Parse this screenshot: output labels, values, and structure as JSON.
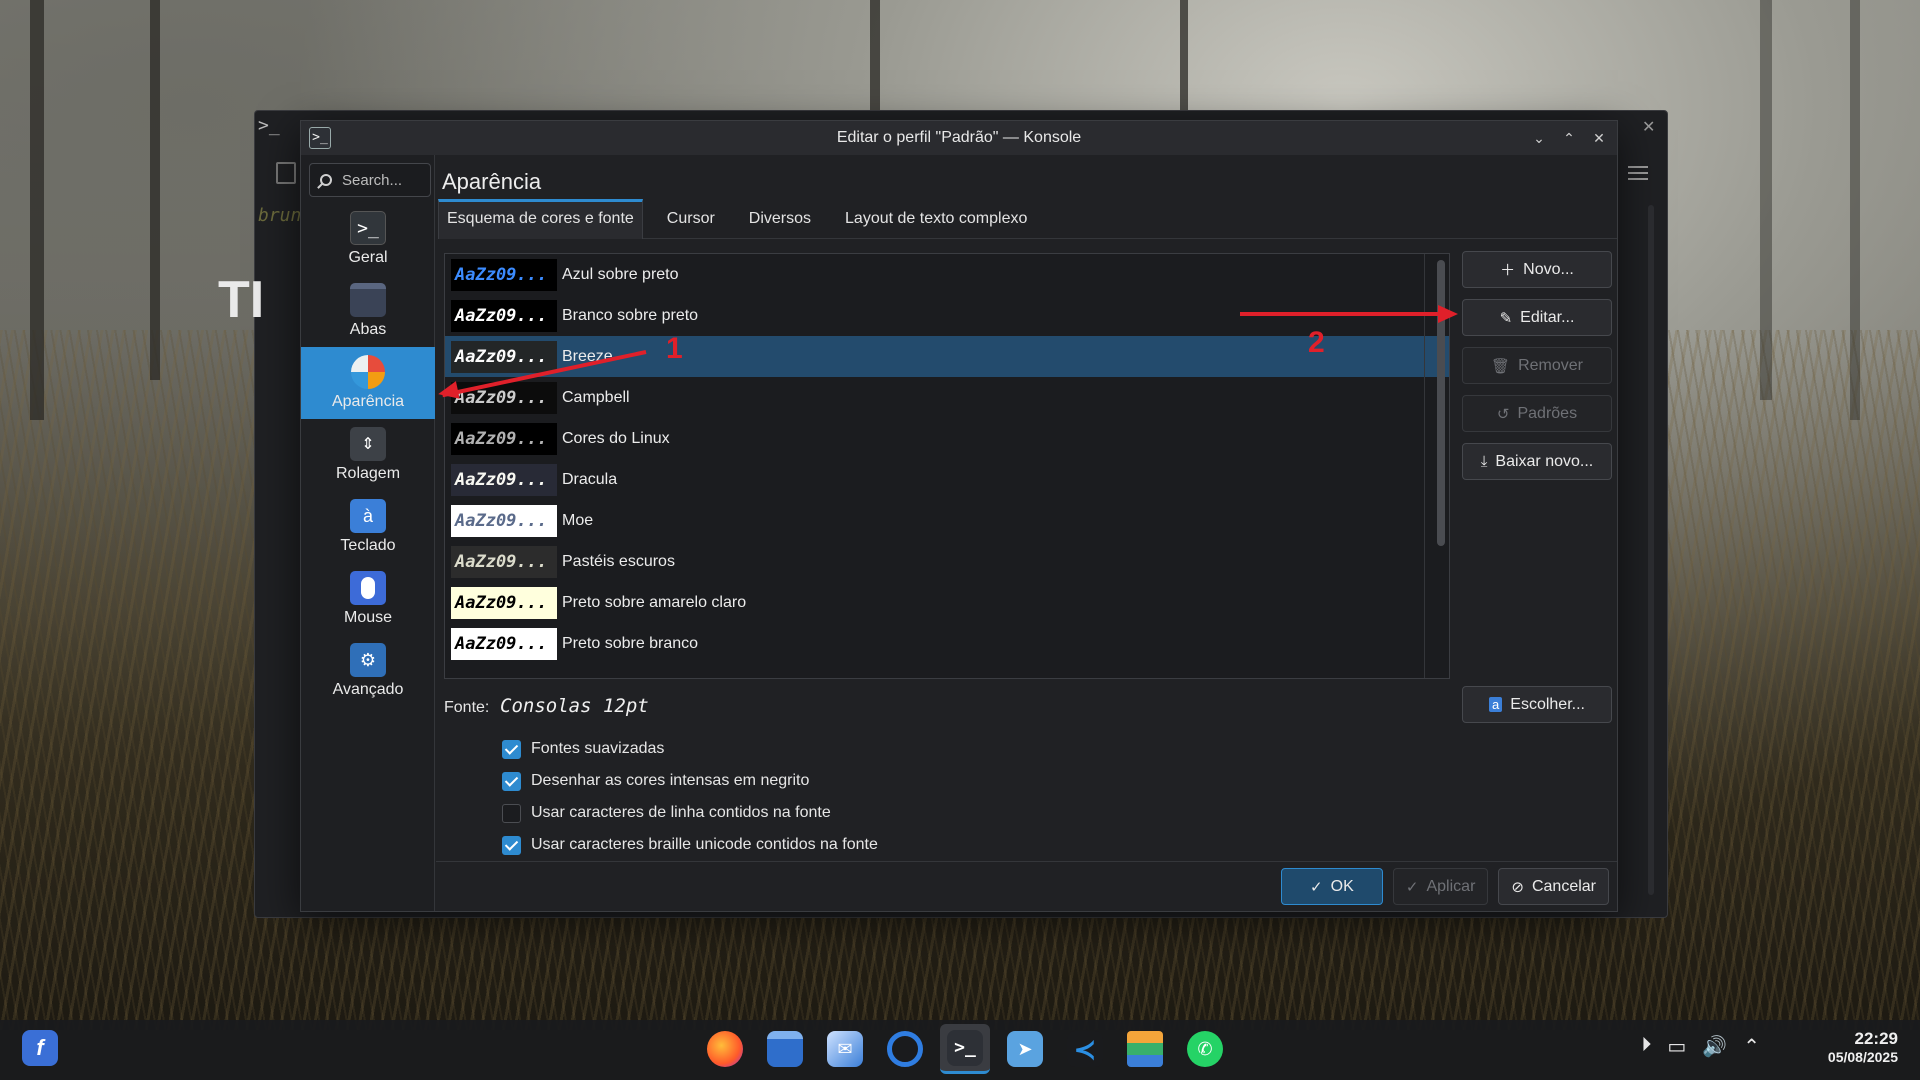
{
  "ghost": {
    "text": "brun",
    "big": "TI"
  },
  "dialog": {
    "title": "Editar o perfil \"Padrão\" — Konsole",
    "search_placeholder": "Search...",
    "page_title": "Aparência"
  },
  "sidebar": {
    "items": [
      {
        "label": "Geral",
        "icon": "terminal-icon"
      },
      {
        "label": "Abas",
        "icon": "tabs-icon"
      },
      {
        "label": "Aparência",
        "icon": "appearance-icon"
      },
      {
        "label": "Rolagem",
        "icon": "scroll-icon"
      },
      {
        "label": "Teclado",
        "icon": "keyboard-icon"
      },
      {
        "label": "Mouse",
        "icon": "mouse-icon"
      },
      {
        "label": "Avançado",
        "icon": "advanced-icon"
      }
    ]
  },
  "tabs": [
    "Esquema de cores e fonte",
    "Cursor",
    "Diversos",
    "Layout de texto complexo"
  ],
  "schemes": {
    "preview_text": "AaZz09...",
    "items": [
      {
        "name": "Azul sobre preto",
        "bg": "#000000",
        "fg": "#3c8cff"
      },
      {
        "name": "Branco sobre preto",
        "bg": "#000000",
        "fg": "#ffffff"
      },
      {
        "name": "Breeze",
        "bg": "#232627",
        "fg": "#fcfcfc"
      },
      {
        "name": "Campbell",
        "bg": "#0c0c0c",
        "fg": "#cccccc"
      },
      {
        "name": "Cores do Linux",
        "bg": "#000000",
        "fg": "#b2b2b2"
      },
      {
        "name": "Dracula",
        "bg": "#282a36",
        "fg": "#f8f8f2"
      },
      {
        "name": "Moe",
        "bg": "#ffffff",
        "fg": "#5a6a8a"
      },
      {
        "name": "Pastéis escuros",
        "bg": "#2c2c2c",
        "fg": "#dcdccc"
      },
      {
        "name": "Preto sobre amarelo claro",
        "bg": "#ffffdd",
        "fg": "#000000"
      },
      {
        "name": "Preto sobre branco",
        "bg": "#ffffff",
        "fg": "#000000"
      }
    ]
  },
  "buttons": {
    "new": "Novo...",
    "edit": "Editar...",
    "remove": "Remover",
    "defaults": "Padrões",
    "download": "Baixar novo...",
    "choose": "Escolher..."
  },
  "font": {
    "label": "Fonte:",
    "value": "Consolas 12pt"
  },
  "checkboxes": [
    {
      "label": "Fontes suavizadas",
      "checked": true
    },
    {
      "label": "Desenhar as cores intensas em negrito",
      "checked": true
    },
    {
      "label": "Usar caracteres de linha contidos na fonte",
      "checked": false
    },
    {
      "label": "Usar caracteres braille unicode contidos na fonte",
      "checked": true
    }
  ],
  "footer": {
    "ok": "OK",
    "apply": "Aplicar",
    "cancel": "Cancelar"
  },
  "annotations": {
    "one": "1",
    "two": "2",
    "color": "#e0202a"
  },
  "taskbar": {
    "time": "22:29",
    "date": "05/08/2025",
    "apps": [
      "firefox-icon",
      "files-icon",
      "mail-icon",
      "browser-icon",
      "konsole-icon",
      "telegram-icon",
      "vscode-icon",
      "stack-icon",
      "whatsapp-icon"
    ]
  }
}
